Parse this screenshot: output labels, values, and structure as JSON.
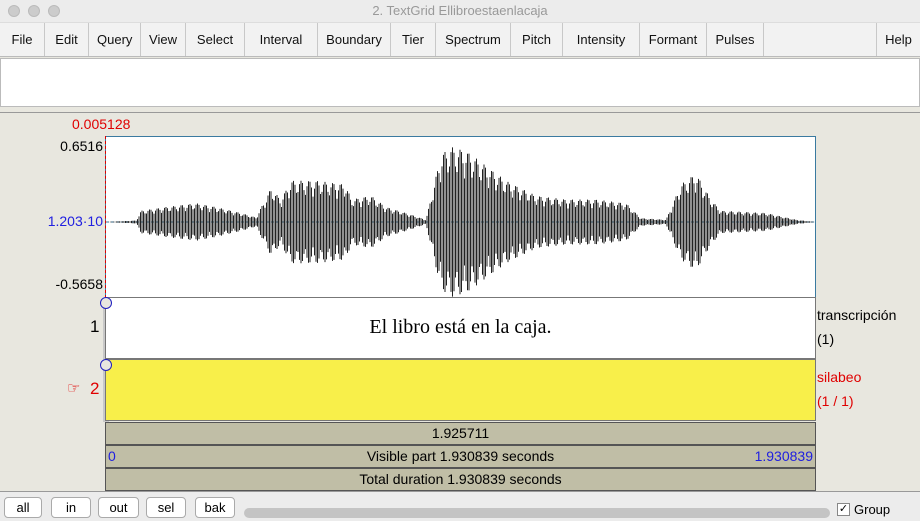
{
  "window": {
    "title": "2. TextGrid Ellibroestaenlacaja"
  },
  "menu": [
    "File",
    "Edit",
    "Query",
    "View",
    "Select",
    "Interval",
    "Boundary",
    "Tier",
    "Spectrum",
    "Pitch",
    "Intensity",
    "Formant",
    "Pulses"
  ],
  "help": "Help",
  "cursor_time": "0.005128",
  "waveform": {
    "max": "0.6516",
    "mid": "1.203·10",
    "min": "-0.5658"
  },
  "tiers": [
    {
      "number": "1",
      "text": "El libro está en la caja.",
      "name": "transcripción",
      "count": "(1)"
    },
    {
      "number": "2",
      "text": "",
      "name": "silabeo",
      "count": "(1 / 1)",
      "selected": true
    }
  ],
  "colors": {
    "selected_tier": "#f8ef4a",
    "accent_red": "#e00000",
    "accent_blue": "#2020e0"
  },
  "bars": {
    "selection": "1.925711",
    "visible_start": "0",
    "visible_label": "Visible part 1.930839 seconds",
    "visible_end": "1.930839",
    "total": "Total duration 1.930839 seconds"
  },
  "buttons": {
    "all": "all",
    "in": "in",
    "out": "out",
    "sel": "sel",
    "bak": "bak"
  },
  "group": {
    "label": "Group",
    "checked": true
  }
}
